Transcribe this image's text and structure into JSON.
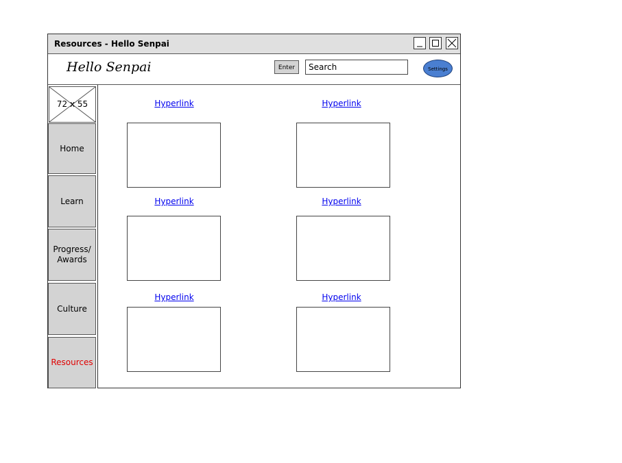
{
  "window": {
    "title": "Resources - Hello Senpai",
    "controls": [
      "minimize-icon",
      "maximize-icon",
      "close-icon"
    ]
  },
  "header": {
    "app_title": "Hello Senpai",
    "enter_label": "Enter",
    "search_value": "Search",
    "settings_label": "Settings"
  },
  "sidebar": {
    "logo_placeholder": "72 x 55",
    "items": [
      {
        "label": "Home",
        "active": false
      },
      {
        "label": "Learn",
        "active": false
      },
      {
        "label": "Progress/\nAwards",
        "active": false
      },
      {
        "label": "Culture",
        "active": false
      },
      {
        "label": "Resources",
        "active": true
      }
    ]
  },
  "main": {
    "cards": [
      {
        "link": "Hyperlink"
      },
      {
        "link": "Hyperlink"
      },
      {
        "link": "Hyperlink"
      },
      {
        "link": "Hyperlink"
      },
      {
        "link": "Hyperlink"
      },
      {
        "link": "Hyperlink"
      }
    ]
  },
  "colors": {
    "active_nav": "#e00000",
    "settings_button": "#4a7fd1",
    "link": "#0000ee",
    "nav_background": "#d3d3d3"
  }
}
